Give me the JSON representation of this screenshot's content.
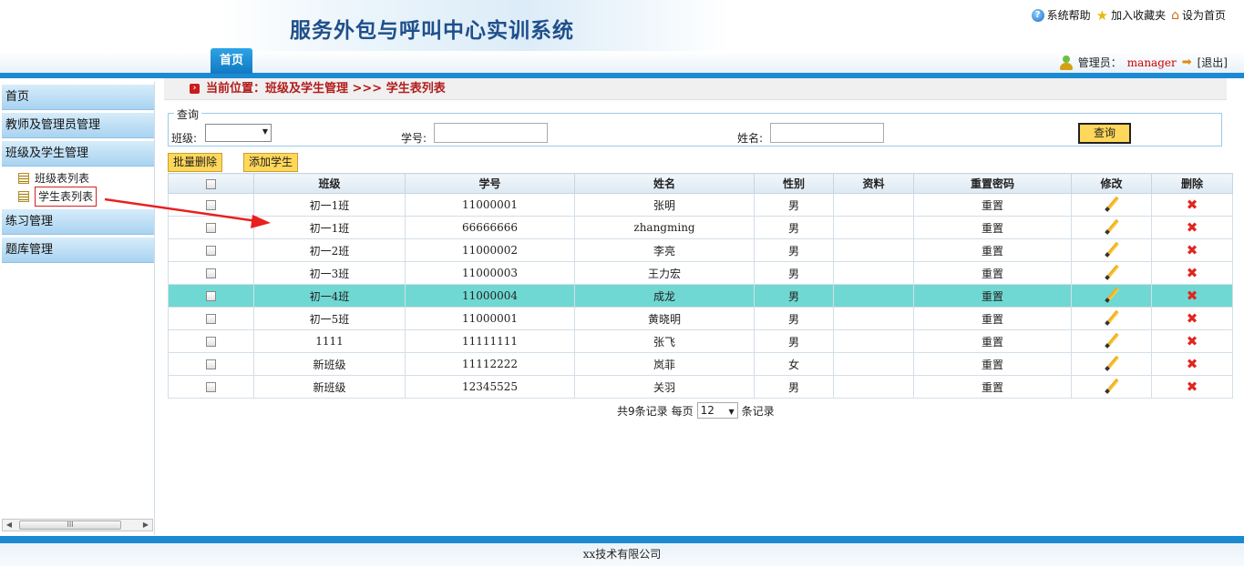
{
  "header": {
    "title": "服务外包与呼叫中心实训系统",
    "links": [
      "系统帮助",
      "加入收藏夹",
      "设为首页"
    ],
    "tab_home": "首页",
    "admin_label": "管理员：",
    "admin_name": "manager",
    "logout": "[退出]"
  },
  "sidebar": {
    "sections": [
      {
        "label": "首页"
      },
      {
        "label": "教师及管理员管理"
      },
      {
        "label": "班级及学生管理",
        "children": [
          "班级表列表",
          "学生表列表"
        ]
      },
      {
        "label": "练习管理"
      },
      {
        "label": "题库管理"
      }
    ],
    "scroll_thumb": "III"
  },
  "breadcrumb": "当前位置：班级及学生管理 >>> 学生表列表",
  "query": {
    "legend": "查询",
    "class_label": "班级:",
    "id_label": "学号:",
    "name_label": "姓名:",
    "button": "查询"
  },
  "actions": {
    "batch_delete": "批量删除",
    "add_student": "添加学生"
  },
  "table": {
    "columns": [
      "班级",
      "学号",
      "姓名",
      "性别",
      "资料",
      "重置密码",
      "修改",
      "删除"
    ],
    "reset_label": "重置",
    "rows": [
      {
        "class": "初一1班",
        "id": "11000001",
        "name": "张明",
        "gender": "男"
      },
      {
        "class": "初一1班",
        "id": "66666666",
        "name": "zhangming",
        "gender": "男"
      },
      {
        "class": "初一2班",
        "id": "11000002",
        "name": "李亮",
        "gender": "男"
      },
      {
        "class": "初一3班",
        "id": "11000003",
        "name": "王力宏",
        "gender": "男"
      },
      {
        "class": "初一4班",
        "id": "11000004",
        "name": "成龙",
        "gender": "男"
      },
      {
        "class": "初一5班",
        "id": "11000001",
        "name": "黄晓明",
        "gender": "男"
      },
      {
        "class": "1111",
        "id": "11111111",
        "name": "张飞",
        "gender": "男"
      },
      {
        "class": "新班级",
        "id": "11112222",
        "name": "岚菲",
        "gender": "女"
      },
      {
        "class": "新班级",
        "id": "12345525",
        "name": "关羽",
        "gender": "男"
      }
    ],
    "highlight_color": "#70d8d2"
  },
  "pager": {
    "total": "共9条记录",
    "per_page_label": "每页",
    "per_page_value": "12",
    "suffix": "条记录"
  },
  "footer": "xx技术有限公司",
  "colors": {
    "accent_blue": "#1b8ad3",
    "title_blue": "#1f4f8b",
    "button_yellow": "#ffd75a",
    "breadcrumb_red": "#b31c1c"
  }
}
